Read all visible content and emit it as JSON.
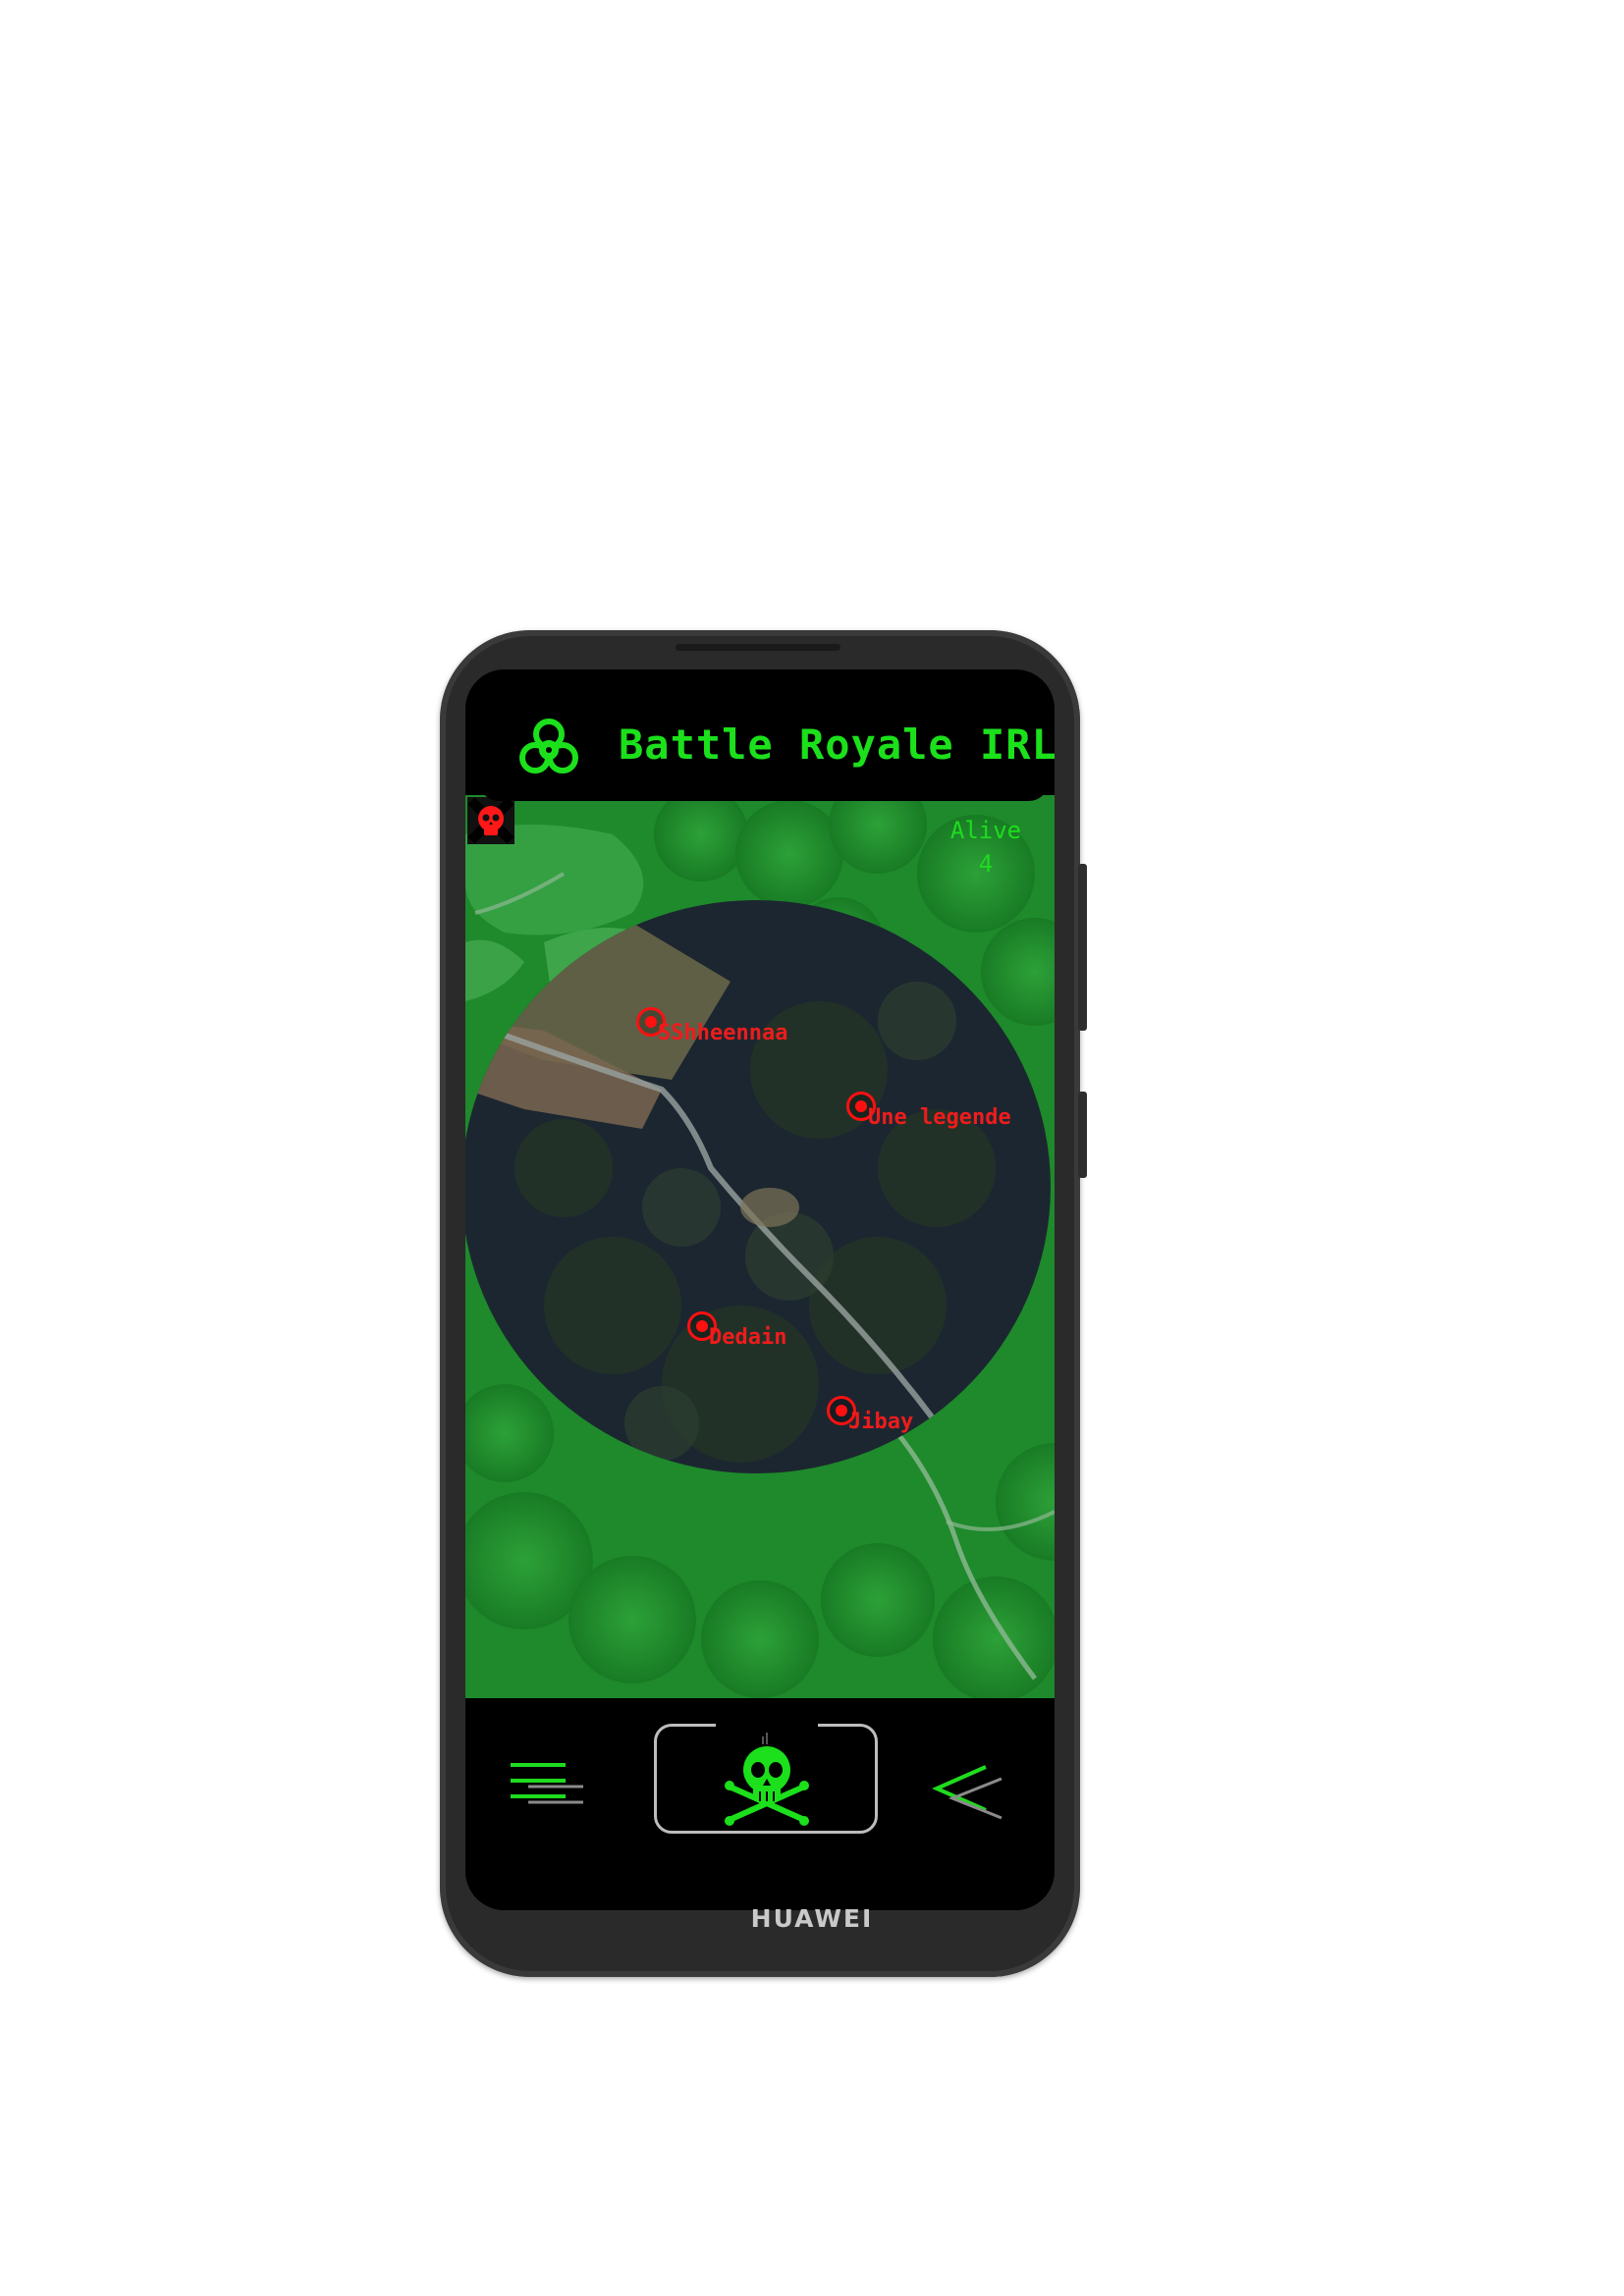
{
  "app": {
    "title": "Battle Royale IRL",
    "device_brand": "HUAWEI"
  },
  "status": {
    "alive_label": "Alive",
    "alive_count": "4"
  },
  "players": [
    {
      "name": "SShheennaa"
    },
    {
      "name": "Une legende"
    },
    {
      "name": "Dedain"
    },
    {
      "name": "Jibay"
    }
  ],
  "icons": {
    "header": "biohazard-icon",
    "danger": "skull-crossbones-icon",
    "nav_left": "menu-icon",
    "nav_center": "skull-crossbones-icon",
    "nav_right": "back-chevron-icon"
  },
  "colors": {
    "accent_green": "#1be01b",
    "player_red": "#ff1010",
    "map_green": "#1f8a2c",
    "safe_zone": "#1e2a36"
  }
}
